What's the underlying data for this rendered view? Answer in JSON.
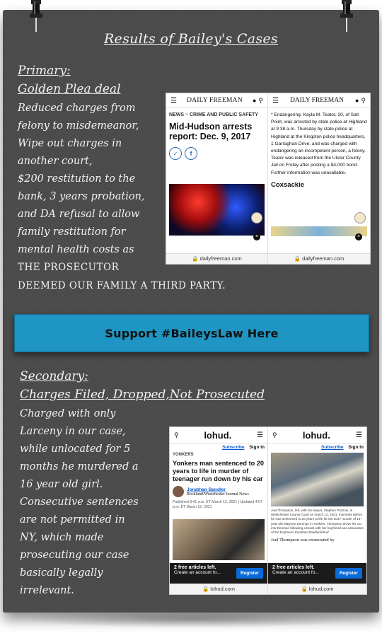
{
  "title": "Results of Bailey's Cases",
  "primary": {
    "heading1": "Primary:",
    "heading2": "Golden Plea deal",
    "body": "Reduced charges from\nfelony to misdemeanor,\nWipe out charges in\nanother court,\n$200 restitution to the\nbank, 3 years probation,\nand DA refusal to allow\nfamily restitution for\nmental health costs as",
    "caps1": "THE PROSECUTOR",
    "caps2": "DEEMED OUR FAMILY A THIRD PARTY."
  },
  "banner": {
    "label": "Support #BaileysLaw Here"
  },
  "secondary": {
    "heading1": "Secondary:",
    "heading2": "Charges Filed, Dropped,Not Prosecuted",
    "body": "Charged with only\nLarceny in our case,\nwhile unlocated for 5\nmonths he murdered a\n16 year old girl.\nConsecutive sentences\nare not permitted in\nNY, which made\nprosecuting our case\nbasically legally\nirrelevant."
  },
  "freeman": {
    "logo": "DAILY FREEMAN",
    "section": "NEWS",
    "subsection": "CRIME AND PUBLIC SAFETY",
    "headline": "Mid-Hudson arrests report: Dec. 9, 2017",
    "article": "* Endangering: Kayla M. Teator, 20, of Salt Point, was arrested by state police at Highland at 9:38 a.m. Thursday by state police at Highland at the Kingston police headquarters, 1 Garraghan Drive, and was charged with endangering an incompetent person, a felony. Teator was released from the Ulster County Jail on Friday after posting a $4,000 bond. Further information was unavailable.",
    "subhead": "Coxsackie",
    "url": "dailyfreeman.com"
  },
  "lohud": {
    "logo": "lohud.",
    "subscribe": "Subscribe",
    "signin": "Sign In",
    "section": "YONKERS",
    "headline": "Yonkers man sentenced to 20 years to life in murder of teenager run down by his car",
    "author": "Jonathan Bandler",
    "outlet": "Rockland/Westchester Journal News",
    "published": "Published 8:41 a.m. ET March 12, 2021",
    "updated": "Updated 4:07 p.m. ET March 12, 2021",
    "caption": "Joel Thompson, left, with his lawyer, Stephen Pozzosi, in Westchester County Court on march 12, 2021, moments before he was sentenced to 20 years to life for the 2017 murder of 16-year-old Matyzee Denman in Yonkers. Thompson drove his car into Denman following a brawl with her boyfriend and associates of the boyfriend",
    "caption_credit": "Jonathan Bandler/lohud",
    "teaser": "Joel Thompson was exonerated by",
    "promo_title": "2 free articles left.",
    "promo_sub": "Create an account fo...",
    "register": "Register",
    "url": "lohud.com"
  }
}
